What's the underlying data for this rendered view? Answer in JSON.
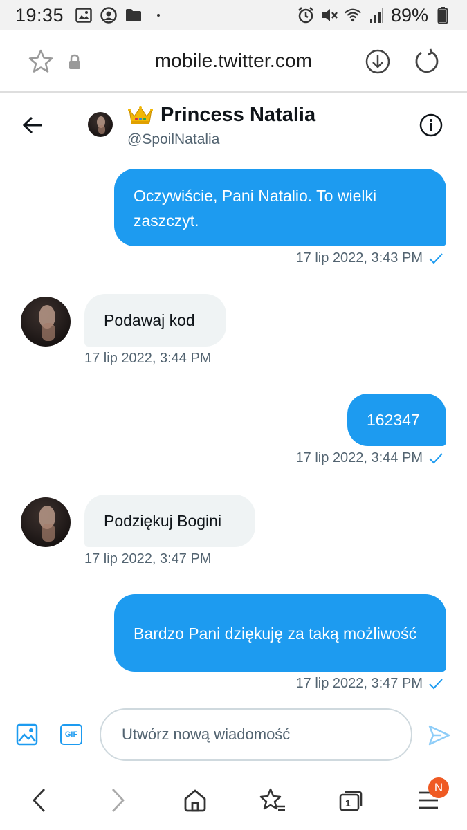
{
  "status_bar": {
    "time": "19:35",
    "battery": "89%"
  },
  "browser": {
    "url": "mobile.twitter.com"
  },
  "conversation": {
    "name": "Princess Natalia",
    "handle": "@SpoilNatalia"
  },
  "messages": [
    {
      "direction": "out",
      "text": "Oczywiście, Pani Natalio. To wielki zaszczyt.",
      "timestamp": "17 lip 2022, 3:43 PM",
      "seen": true
    },
    {
      "direction": "in",
      "text": "Podawaj kod",
      "timestamp": "17 lip 2022, 3:44 PM"
    },
    {
      "direction": "out",
      "text": "162347",
      "timestamp": "17 lip 2022, 3:44 PM",
      "seen": true
    },
    {
      "direction": "in",
      "text": "Podziękuj Bogini",
      "timestamp": "17 lip 2022, 3:47 PM"
    },
    {
      "direction": "out",
      "text": "Bardzo Pani dziękuję za taką możliwość",
      "timestamp": "17 lip 2022, 3:47 PM",
      "seen": true
    }
  ],
  "composer": {
    "gif_label": "GIF",
    "placeholder": "Utwórz nową wiadomość"
  },
  "nav": {
    "tabs_count": "1",
    "menu_badge": "N"
  },
  "colors": {
    "accent": "#1d9bf0",
    "incoming_bubble": "#eff3f4",
    "meta_text": "#536471",
    "badge": "#ef5a23"
  },
  "icons": [
    "image-icon",
    "person-circle-icon",
    "folder-icon",
    "alarm-icon",
    "mute-icon",
    "wifi-icon",
    "signal-icon",
    "battery-icon",
    "star-icon",
    "lock-icon",
    "download-icon",
    "reload-icon",
    "back-arrow-icon",
    "crown-icon",
    "info-icon",
    "media-icon",
    "send-icon",
    "chevron-left-icon",
    "chevron-right-icon",
    "home-icon",
    "star-list-icon",
    "tabs-icon",
    "menu-icon"
  ]
}
